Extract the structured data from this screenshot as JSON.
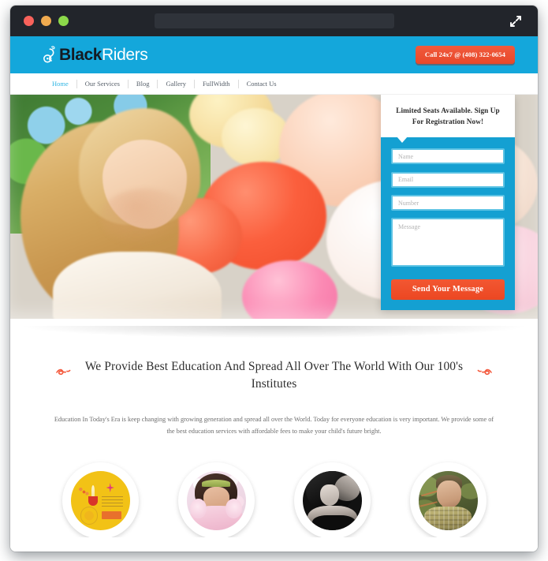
{
  "window": {
    "traffic_lights": [
      "close",
      "minimize",
      "maximize"
    ],
    "url_value": "",
    "expand_icon": "expand-arrows-icon"
  },
  "site_header": {
    "logo": {
      "icon": "scooter-icon",
      "text_primary": "Black",
      "text_secondary": "Riders"
    },
    "call_button_label": "Call 24x7 @ (408) 322-0654"
  },
  "nav": {
    "items": [
      {
        "label": "Home",
        "active": true
      },
      {
        "label": "Our Services",
        "active": false
      },
      {
        "label": "Blog",
        "active": false
      },
      {
        "label": "Gallery",
        "active": false
      },
      {
        "label": "FullWidth",
        "active": false
      },
      {
        "label": "Contact Us",
        "active": false
      }
    ]
  },
  "hero": {
    "alt": "Smiling blonde woman holding colorful balloons outdoors"
  },
  "signup_form": {
    "callout_text": "Limited Seats Available. Sign Up For Registration Now!",
    "fields": [
      {
        "name": "name",
        "placeholder": "Name",
        "value": ""
      },
      {
        "name": "email",
        "placeholder": "Email",
        "value": ""
      },
      {
        "name": "number",
        "placeholder": "Number",
        "value": ""
      },
      {
        "name": "message",
        "placeholder": "Message",
        "value": ""
      }
    ],
    "submit_label": "Send Your Message"
  },
  "content": {
    "headline": "We Provide Best Education And Spread All Over The World With Our 100's Institutes",
    "paragraph": "Education In Today's Era is keep changing with growing generation and spread all over the World. Today for everyone education is very important. We provide some of the best education services with affordable fees to make your child's future bright.",
    "ornament_left": "flourish-ornament-icon",
    "ornament_right": "flourish-ornament-icon"
  },
  "avatars": [
    {
      "name": "festival-greeting-card",
      "alt": "Yellow festival greeting card graphic"
    },
    {
      "name": "girl-in-pink",
      "alt": "Young girl wearing pink winter coat"
    },
    {
      "name": "woman-portrait-bw",
      "alt": "Black and white portrait of a woman"
    },
    {
      "name": "man-portrait",
      "alt": "Portrait of a man in olive green setting"
    }
  ],
  "colors": {
    "brand_blue": "#14a7db",
    "panel_blue": "#14a0d2",
    "accent_orange": "#f04e28",
    "call_button": "#ee4f31",
    "titlebar_dark": "#22252b",
    "nav_active": "#2fb5e4",
    "text_dark": "#2e2e2e",
    "text_muted": "#6d6d6d"
  }
}
